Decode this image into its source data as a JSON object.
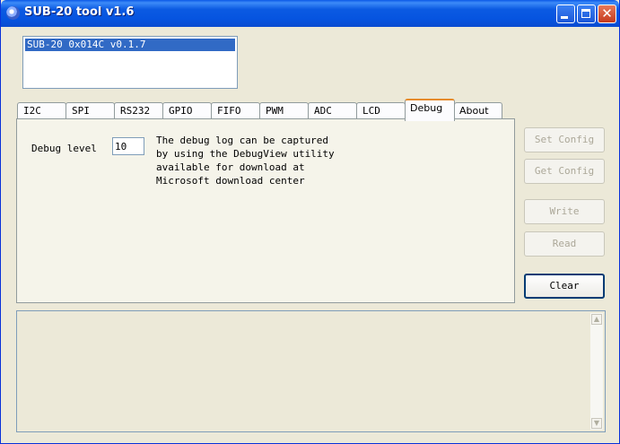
{
  "window": {
    "title": "SUB-20 tool v1.6"
  },
  "devices": {
    "items": [
      "SUB-20 0x014C v0.1.7"
    ]
  },
  "tabs": [
    "I2C",
    "SPI",
    "RS232",
    "GPIO",
    "FIFO",
    "PWM",
    "ADC",
    "LCD",
    "Debug",
    "About"
  ],
  "active_tab": "Debug",
  "debug": {
    "level_label": "Debug level",
    "level_value": "10",
    "note": "The debug log can be captured\nby using the DebugView utility\navailable for download at\nMicrosoft download center"
  },
  "buttons": {
    "set_config": "Set Config",
    "get_config": "Get Config",
    "write": "Write",
    "read": "Read",
    "clear": "Clear"
  },
  "icons": {
    "up": "▲",
    "down": "▼",
    "close": "✕"
  },
  "colors": {
    "titlebar": "#0a58e7",
    "selection": "#316ac5",
    "active_tab_accent": "#e68b2c"
  }
}
